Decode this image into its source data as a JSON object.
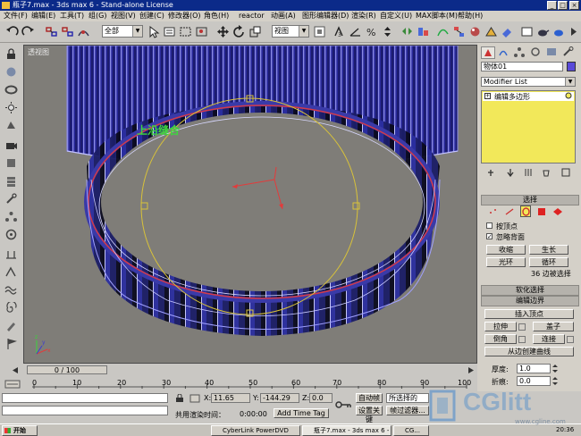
{
  "window": {
    "title": "瓶子7.max - 3ds max 6 - Stand-alone License",
    "min": "_",
    "max": "□",
    "close": "×"
  },
  "menu": [
    "文件(F)",
    "编辑(E)",
    "工具(T)",
    "组(G)",
    "视图(V)",
    "创建(C)",
    "修改器(O)",
    "角色(H)",
    "reactor",
    "动画(A)",
    "图形编辑器(D)",
    "渲染(R)",
    "自定义(U)",
    "MAX脚本(M)",
    "帮助(H)"
  ],
  "toolbar": {
    "selection_filter": "全部",
    "ref_coord": "视图"
  },
  "viewport": {
    "label": "透视图",
    "annotation": "上沿缝合"
  },
  "command_panel": {
    "object_name": "物体01",
    "modifier_list": "Modifier List",
    "stack_item": "编辑多边形",
    "selection_header": "选择",
    "by_vertex": "按顶点",
    "ignore_backfacing": "忽略背面",
    "shrink": "收缩",
    "grow": "生长",
    "ring": "光环",
    "loop": "循环",
    "selected_count": "36 边被选择",
    "soft_selection_header": "软化选择",
    "edit_borders_header": "编辑边界",
    "insert_vertex": "插入顶点",
    "extrude": "拉伸",
    "cap": "盖子",
    "chamfer": "倒角",
    "connect": "连接",
    "create_shape": "从边创建曲线",
    "thickness_label": "厚度:",
    "thickness_value": "1.0",
    "fold_label": "折痕:",
    "fold_value": "0.0"
  },
  "timeline": {
    "frame": "0 / 100",
    "ticks": [
      "0",
      "10",
      "20",
      "30",
      "40",
      "50",
      "60",
      "70",
      "80",
      "90",
      "100"
    ]
  },
  "status": {
    "x_label": "X:",
    "x": "11.65",
    "y_label": "Y:",
    "y": "-144.29",
    "z_label": "Z:",
    "z": "0.0",
    "auto_key": "自动帧",
    "set_key": "设置关键",
    "selected": "所选择的",
    "filter": "帧过滤器...",
    "prompt": "共用渲染时间：",
    "time": "0:00:00",
    "add_time_tag": "Add Time Tag"
  },
  "taskbar": {
    "start": "开始",
    "tasks": [
      "CyberLink PowerDVD",
      "瓶子7.max - 3ds max 6 -",
      "CG..."
    ],
    "clock": "20:36"
  },
  "watermark": {
    "brand": "CGlitt",
    "url": "www.cgline.com"
  }
}
